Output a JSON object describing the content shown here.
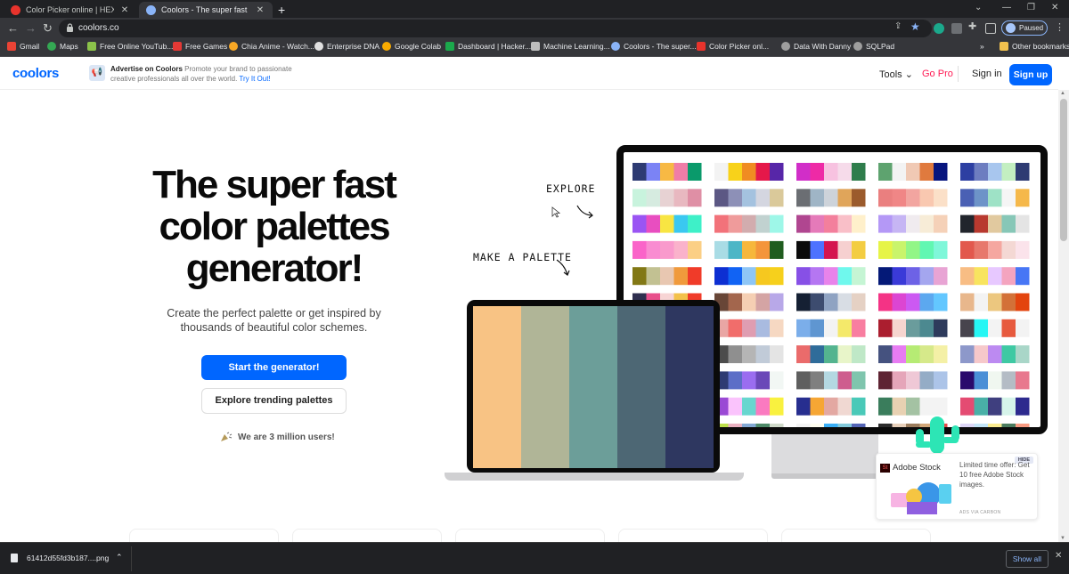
{
  "browser": {
    "tabs": [
      {
        "title": "Color Picker online | HEX Color",
        "active": false,
        "favicon_color": "#e8332c"
      },
      {
        "title": "Coolors - The super fast color palette",
        "active": true,
        "favicon_color": "#8ab4f8"
      }
    ],
    "new_tab_icon": "plus-icon",
    "url": "coolors.co",
    "profile_status": "Paused"
  },
  "bookmarks": [
    {
      "label": "Gmail",
      "icon_color": "#ea4335"
    },
    {
      "label": "Maps",
      "icon_color": "#34a853"
    },
    {
      "label": "Free Online YouTub...",
      "icon_color": "#8bc34a"
    },
    {
      "label": "Free Games",
      "icon_color": "#e53935"
    },
    {
      "label": "Chia Anime - Watch...",
      "icon_color": "#f9a825"
    },
    {
      "label": "Enterprise DNA",
      "icon_color": "#e0e0e0"
    },
    {
      "label": "Google Colab",
      "icon_color": "#f9ab00"
    },
    {
      "label": "Dashboard | Hacker...",
      "icon_color": "#1ba94c"
    },
    {
      "label": "Machine Learning...",
      "icon_color": "#bdbdbd"
    },
    {
      "label": "Coolors - The super...",
      "icon_color": "#8ab4f8"
    },
    {
      "label": "Color Picker onl...",
      "icon_color": "#e8332c"
    },
    {
      "label": "Data With Danny",
      "icon_color": "#9e9e9e"
    },
    {
      "label": "SQLPad",
      "icon_color": "#9e9e9e"
    }
  ],
  "bookmarks_more": "»",
  "other_bookmarks": "Other bookmarks",
  "site_header": {
    "logo": "coolors",
    "ad_title": "Advertise on Coolors",
    "ad_text": "Promote your brand to passionate creative professionals all over the world.",
    "ad_link": "Try It Out!",
    "tools": "Tools",
    "go_pro": "Go Pro",
    "sign_in": "Sign in",
    "sign_up": "Sign up"
  },
  "hero": {
    "title": "The super fast color palettes generator!",
    "subtitle": "Create the perfect palette or get inspired by thousands of beautiful color schemes.",
    "cta_primary": "Start the generator!",
    "cta_secondary": "Explore trending palettes",
    "users": "We are 3 million users!"
  },
  "illustration": {
    "explore_label": "EXPLORE",
    "make_palette_label": "MAKE A PALETTE",
    "laptop_palette": [
      "#f8c384",
      "#b0b597",
      "#6c9e99",
      "#4d6774",
      "#2e3760"
    ],
    "monitor_palettes": [
      [
        "#2e3b73",
        "#7b83f5",
        "#f7b944",
        "#f07da7",
        "#0a9a6b",
        "#f3f3f3",
        "#f8d21a",
        "#f08c22",
        "#e5184a",
        "#5726a8",
        "#d12ec8",
        "#ee2aa6",
        "#f7c2e0",
        "#f6dbea",
        "#2f7d4c",
        "#5ea36f",
        "#f3f3f3",
        "#f0c9b4",
        "#e07a3e",
        "#07157e",
        "#2d3fa2",
        "#6d7dc0",
        "#a8c6ee",
        "#c3efc1"
      ],
      [
        "#c8f3dd",
        "#d6ebe0",
        "#e7d2d3",
        "#e8b8c0",
        "#df8fa5",
        "#5c5884",
        "#8d90b7",
        "#a4c2df",
        "#d4d6e0",
        "#dac99a",
        "#6b6e73",
        "#9fb5c6",
        "#cdd3da",
        "#e0a55a",
        "#9b5b2c",
        "#ea7f7f",
        "#f08686",
        "#f2a5a0",
        "#f9c8b0",
        "#fbe0c8",
        "#4a60b4",
        "#6d93c8",
        "#9ee2c6",
        "#f5f5f5",
        "#f5b84a"
      ],
      [
        "#9a55f3",
        "#e84ec0",
        "#f8e542",
        "#3ac8f0",
        "#3ef0c8",
        "#f2727a",
        "#ef9b9b",
        "#d2acae",
        "#c1d2d0",
        "#9ef7e8",
        "#b04690",
        "#e57ab9",
        "#f37f9c",
        "#f9bfc8",
        "#fff0cb",
        "#b498f6",
        "#c6b5f4",
        "#f0ebef",
        "#f7ecd7",
        "#f5d1b8",
        "#21252c",
        "#b8392f",
        "#e1c99f",
        "#87c7b7",
        "#e4e4e4"
      ],
      [
        "#fa64c9",
        "#f98cd1",
        "#f99acc",
        "#fab2cb",
        "#fbcf85",
        "#a9dce5",
        "#4cb6c6",
        "#f6b73c",
        "#f4953b",
        "#205d1f",
        "#0b0b0b",
        "#4d72ff",
        "#d4154f",
        "#f6d0d0",
        "#f3cd42",
        "#e6f447",
        "#c9f46b",
        "#92f687",
        "#61f7b2",
        "#7ff7d9",
        "#e2584d",
        "#e7786c",
        "#f5a7a0",
        "#f4d8d4",
        "#fbe3eb"
      ],
      [
        "#827815",
        "#c2c192",
        "#e8c7b1",
        "#f09a3c",
        "#f03b29",
        "#0d2fd2",
        "#1163f4",
        "#8ec6f6",
        "#f6c81f",
        "#f6d01c",
        "#8750e6",
        "#b576f2",
        "#e883ea",
        "#6ff8ed",
        "#c5f5d4",
        "#041977",
        "#3a3ad8",
        "#6d62e6",
        "#a4a6ef",
        "#e8a4d4",
        "#f8bd84",
        "#f8e45f",
        "#e7c8ff",
        "#f4a4bf",
        "#4776f5"
      ],
      [
        "#2f2f4f",
        "#e84f8b",
        "#f7d5d5",
        "#f3c14b",
        "#f03b29",
        "#684637",
        "#a3664d",
        "#f5cfb3",
        "#d4a4a4",
        "#b8a8e8",
        "#152033",
        "#3d4c6f",
        "#8fa3c2",
        "#d8dde4",
        "#e5d1c4",
        "#f43385",
        "#dc45d2",
        "#cc59f2",
        "#5ca8ef",
        "#63c7ff",
        "#e8b78c",
        "#f3f3f3",
        "#ecc77f",
        "#d37138",
        "#e3440e"
      ],
      [
        "#3e4455",
        "#9bcfd6",
        "#5ab4bb",
        "#b8dce0",
        "#f6f3e8",
        "#e9a6a4",
        "#f16d6b",
        "#df9db1",
        "#a9bbe0",
        "#f6d8c2",
        "#7baeea",
        "#5f96d1",
        "#f3f3f3",
        "#f4e96a",
        "#f87ea0",
        "#ab1e2f",
        "#f6d5cf",
        "#6a9c9c",
        "#4c8990",
        "#2e3b5c",
        "#47444d",
        "#26f6f4",
        "#f3f3f3",
        "#e75a3e",
        "#f3f3f3"
      ],
      [
        "#f3f3f3",
        "#1c1c1c",
        "#d262a5",
        "#f7a4d1",
        "#fad641",
        "#4c4c4c",
        "#8f8f8f",
        "#b5b5b5",
        "#c1cbd8",
        "#e4e4e4",
        "#ea6b6b",
        "#2f6c9a",
        "#54b48f",
        "#e8f5c9",
        "#bfe8c7",
        "#45527f",
        "#e77cf2",
        "#b6eb74",
        "#d6e98a",
        "#f4f0a6",
        "#8d98ca",
        "#f6c8ca",
        "#bc8af1",
        "#3ec9a3",
        "#a9d6c8"
      ],
      [
        "#3d6e5c",
        "#f64b33",
        "#e8691b",
        "#f7ab4b",
        "#f9d16d",
        "#2e3b73",
        "#5c6ec7",
        "#9a6df0",
        "#6a48b8",
        "#f2f7f4",
        "#5f5f5f",
        "#7f7f7f",
        "#b4d8e2",
        "#ce5d8e",
        "#7fc5ad",
        "#5e2433",
        "#e5a5b9",
        "#efc8d6",
        "#94acc6",
        "#acc4e8",
        "#2a0a6c",
        "#4a8fd6",
        "#f0f7f0",
        "#b4bcc5",
        "#e8788e"
      ],
      [
        "#1e1e1e",
        "#f0b8c5",
        "#20b44c",
        "#f7cf18",
        "#f9e2b4",
        "#9a49d4",
        "#fac3fc",
        "#68d6cf",
        "#fa7ac0",
        "#f9f13f",
        "#272e8f",
        "#f6a634",
        "#e3a8a2",
        "#f0d8d2",
        "#4ac9b8",
        "#3a7d5c",
        "#e8d1b2",
        "#a4c2a3",
        "#f3f3f3",
        "#f3f3f3",
        "#e44b72",
        "#49b0a7",
        "#3f3f7f",
        "#d6f4ea",
        "#2d2a8e"
      ],
      [
        "#c8c8c8",
        "#2e3b73",
        "#f06a7d",
        "#f59f42",
        "#e5e7e3",
        "#bde04a",
        "#eab1c1",
        "#83a8d3",
        "#4e8a68",
        "#cfd9c9",
        "#f4f4f4",
        "#fffef0",
        "#3aaef5",
        "#83cadb",
        "#5465b6",
        "#2d2d2d",
        "#e8d0ba",
        "#9b7c5c",
        "#d2a779",
        "#e84a4a",
        "#ddd6f6",
        "#c3e5f7",
        "#faeb8f",
        "#4b7c5f",
        "#f99b82"
      ]
    ]
  },
  "carbon_ad": {
    "hide": "HIDE",
    "brand": "Adobe Stock",
    "brand_badge": "St",
    "message": "Limited time offer: Get 10 free Adobe Stock images.",
    "via": "ADS VIA CARBON"
  },
  "download_bar": {
    "filename": "61412d55fd3b187....png",
    "show_all": "Show all"
  }
}
